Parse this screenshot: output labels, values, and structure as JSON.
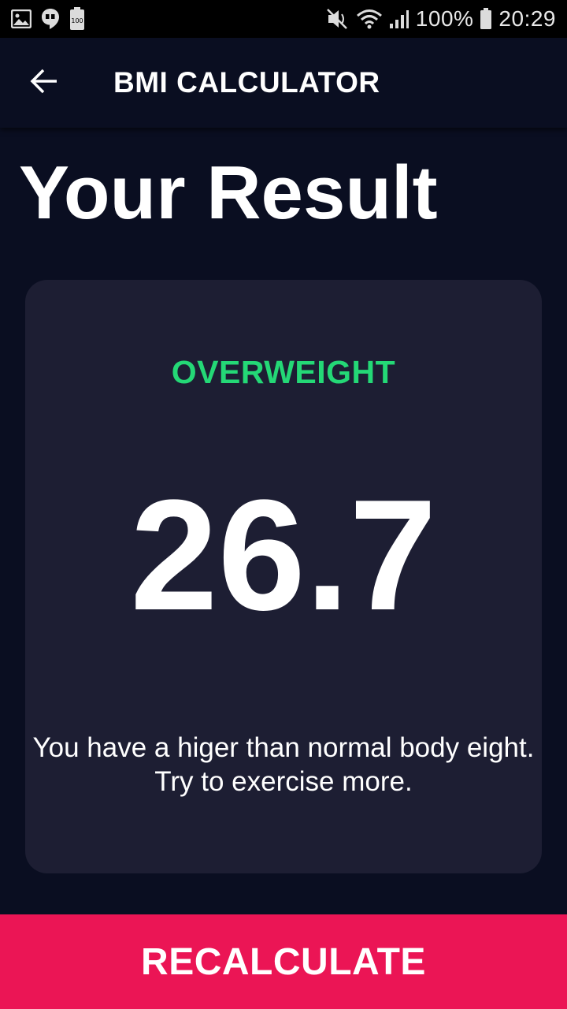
{
  "status_bar": {
    "battery_percent": "100%",
    "time": "20:29",
    "icons_left": [
      "image-icon",
      "hangouts-icon",
      "battery-100-icon"
    ],
    "icons_right": [
      "mute-icon",
      "wifi-icon",
      "signal-icon",
      "battery-icon"
    ]
  },
  "app_bar": {
    "back_icon": "arrow-back-icon",
    "title": "BMI CALCULATOR"
  },
  "page": {
    "title": "Your Result"
  },
  "result": {
    "status": "OVERWEIGHT",
    "bmi": "26.7",
    "message_line1": "You have a higer than normal body eight.",
    "message_line2": "Try to exercise more."
  },
  "button": {
    "label": "RECALCULATE"
  },
  "colors": {
    "background": "#0a0e21",
    "card": "#1d1e33",
    "status_green": "#24d876",
    "accent_pink": "#eb1555"
  }
}
